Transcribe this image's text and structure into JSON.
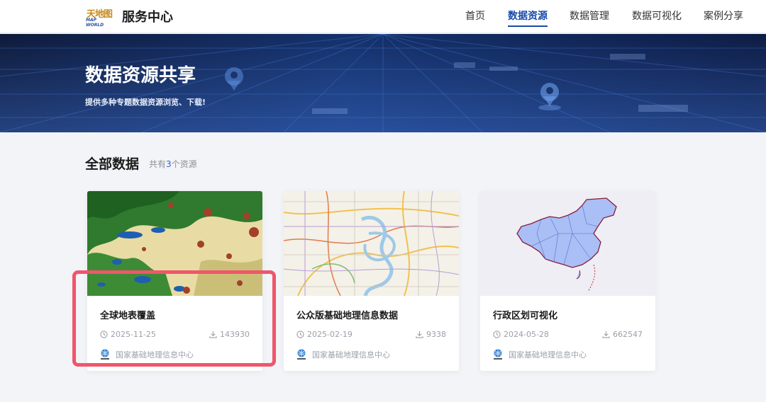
{
  "header": {
    "logo_top": "天地图",
    "logo_bottom": "MAP WORLD",
    "brand": "服务中心",
    "nav": [
      {
        "label": "首页",
        "active": false
      },
      {
        "label": "数据资源",
        "active": true
      },
      {
        "label": "数据管理",
        "active": false
      },
      {
        "label": "数据可视化",
        "active": false
      },
      {
        "label": "案例分享",
        "active": false
      }
    ]
  },
  "banner": {
    "title": "数据资源共享",
    "subtitle": "提供多种专题数据资源浏览、下载!"
  },
  "section": {
    "title": "全部数据",
    "count_prefix": "共有",
    "count": "3",
    "count_suffix": "个资源"
  },
  "cards": [
    {
      "title": "全球地表覆盖",
      "date": "2025-11-25",
      "downloads": "143930",
      "provider": "国家基础地理信息中心",
      "image": "land-cover-map"
    },
    {
      "title": "公众版基础地理信息数据",
      "date": "2025-02-19",
      "downloads": "9338",
      "provider": "国家基础地理信息中心",
      "image": "city-road-map"
    },
    {
      "title": "行政区划可视化",
      "date": "2024-05-28",
      "downloads": "662547",
      "provider": "国家基础地理信息中心",
      "image": "china-admin-map"
    }
  ],
  "colors": {
    "accent": "#1a4ba8",
    "annotation": "#f0566b",
    "muted": "#9aa0aa"
  }
}
